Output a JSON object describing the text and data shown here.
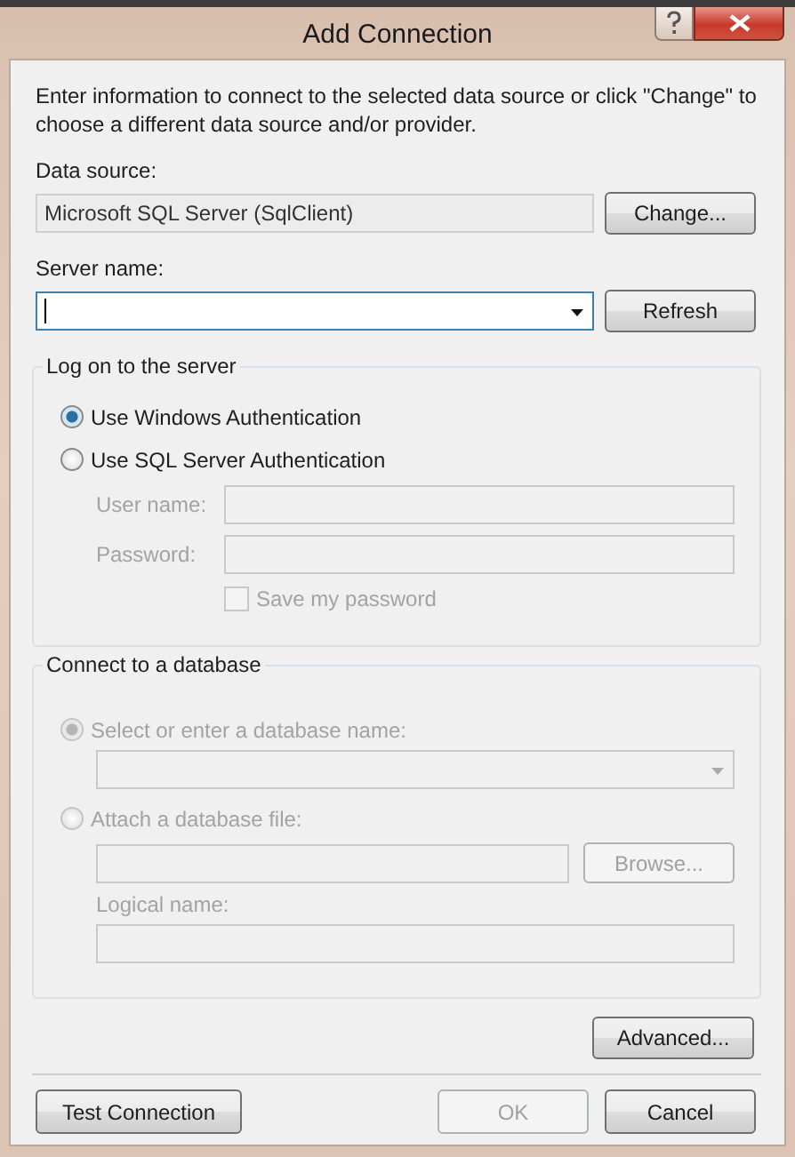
{
  "window": {
    "title": "Add Connection"
  },
  "description": "Enter information to connect to the selected data source or click \"Change\" to choose a different data source and/or provider.",
  "data_source": {
    "label": "Data source:",
    "value": "Microsoft SQL Server (SqlClient)",
    "button": "Change..."
  },
  "server_name": {
    "label": "Server name:",
    "button": "Refresh"
  },
  "log_on": {
    "legend": "Log on to the server",
    "options": [
      {
        "label": "Use Windows Authentication",
        "selected": true
      },
      {
        "label": "Use SQL Server Authentication",
        "selected": false
      }
    ],
    "fields": [
      {
        "label": "User name:",
        "disabled": true
      },
      {
        "label": "Password:",
        "disabled": true
      }
    ],
    "save_password": {
      "label": "Save my password",
      "checked": false,
      "disabled": true
    }
  },
  "database": {
    "legend": "Connect to a database",
    "options": [
      {
        "label": "Select or enter a database name:",
        "selected": true,
        "disabled": true
      },
      {
        "label": "Attach a database file:",
        "selected": false,
        "disabled": true
      }
    ],
    "database_name": {
      "disabled": true
    },
    "file": {
      "disabled": true,
      "button": "Browse..."
    },
    "logical_name": {
      "label": "Logical name:",
      "disabled": true
    }
  },
  "advanced_button": {
    "label": "Advanced...",
    "disabled": false
  },
  "buttons": [
    {
      "label": "Test Connection",
      "disabled": false
    },
    {
      "label": "OK",
      "disabled": true
    },
    {
      "label": "Cancel",
      "disabled": false
    }
  ]
}
